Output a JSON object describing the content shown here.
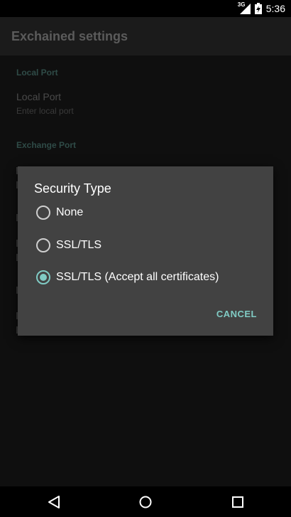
{
  "status_bar": {
    "network": "3G",
    "time": "5:36"
  },
  "app_bar": {
    "title": "Exchained settings"
  },
  "settings": {
    "local_section": "Local Port",
    "local_port_title": "Local Port",
    "local_port_summary": "Enter local port",
    "exchange_section": "Exchange Port"
  },
  "dialog": {
    "title": "Security Type",
    "options": [
      {
        "label": "None",
        "checked": false
      },
      {
        "label": "SSL/TLS",
        "checked": false
      },
      {
        "label": "SSL/TLS (Accept all certificates)",
        "checked": true
      }
    ],
    "cancel_label": "CANCEL"
  },
  "nav_bar": {
    "icons": [
      "back-icon",
      "home-icon",
      "recents-icon"
    ]
  },
  "colors": {
    "accent": "#80cbc4",
    "dialog_bg": "#424242",
    "screen_bg": "#0f0f0f"
  }
}
